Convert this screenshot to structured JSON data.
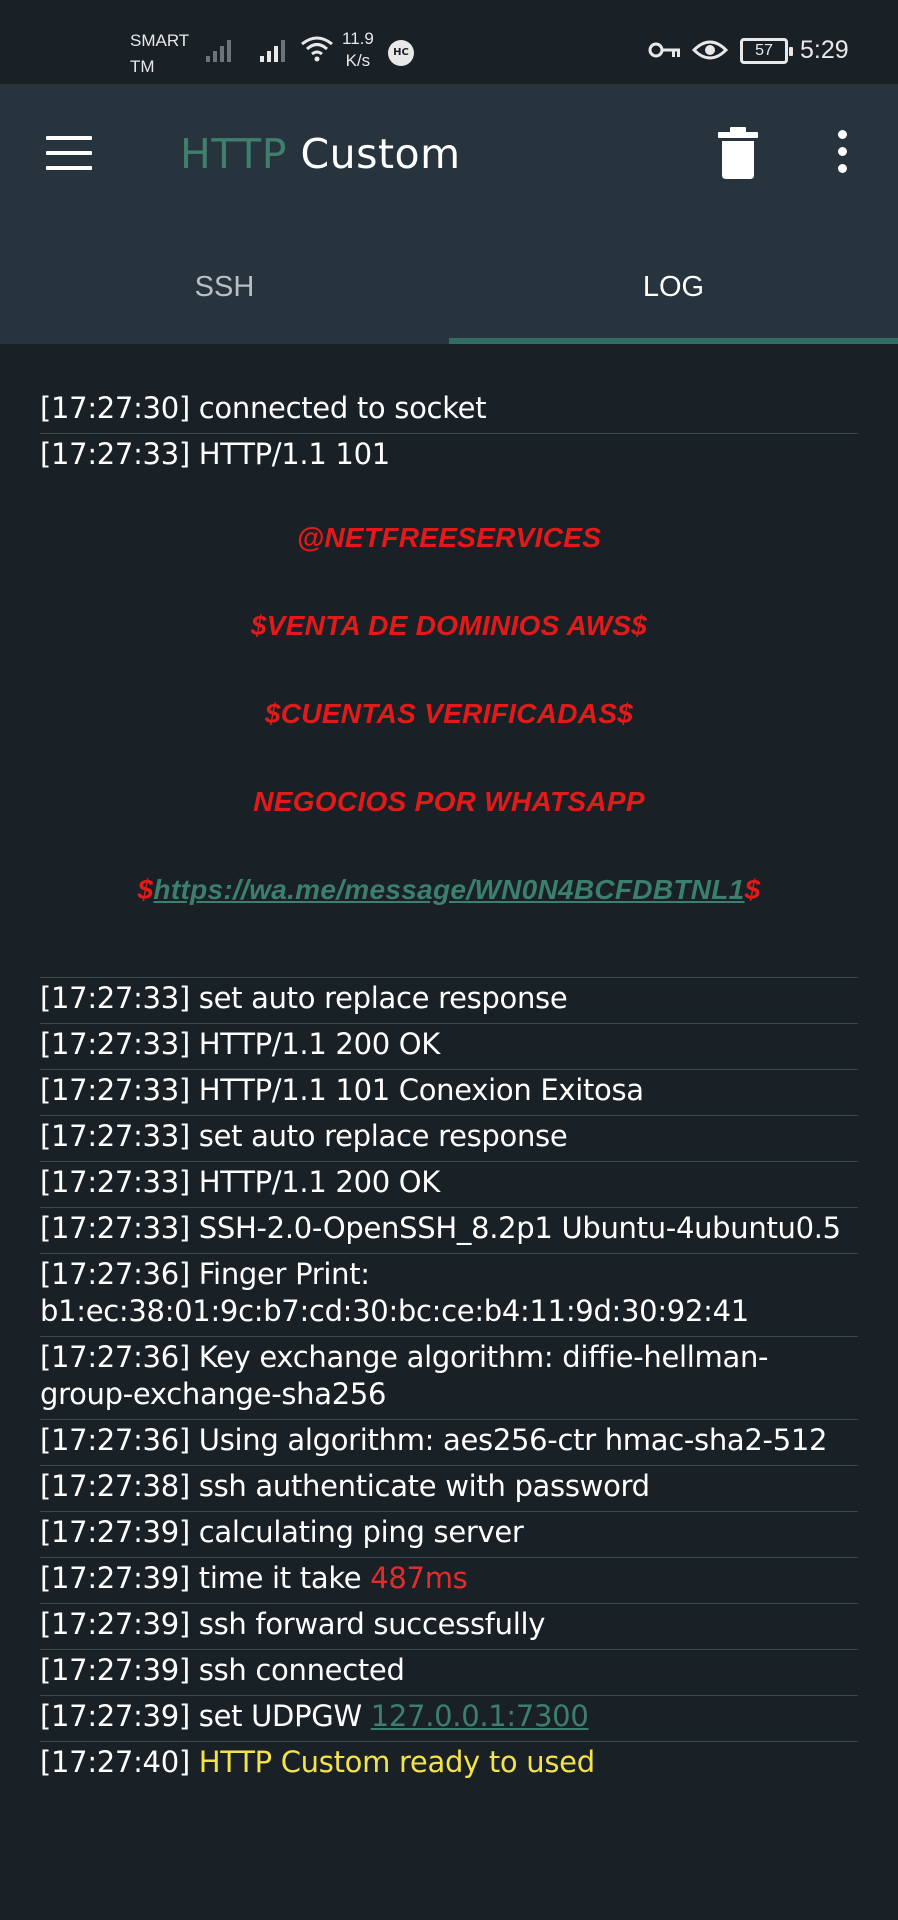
{
  "status_bar": {
    "carrier_line1": "SMART",
    "carrier_line2": "TM",
    "speed_value": "11.9",
    "speed_unit": "K/s",
    "hc_badge": "HC",
    "battery_level": "57",
    "time": "5:29"
  },
  "app_bar": {
    "title_part1": "HTTP",
    "title_part2": " Custom",
    "menu_icon": "hamburger-menu-icon",
    "delete_icon": "trash-icon",
    "more_icon": "more-vert-icon"
  },
  "tabs": [
    {
      "label": "SSH",
      "active": false
    },
    {
      "label": "LOG",
      "active": true
    }
  ],
  "colors": {
    "background": "#1a2126",
    "app_bar": "#28343d",
    "accent_green": "#3c7f6c",
    "banner_red": "#e41a1a",
    "ready_yellow": "#f3e24a"
  },
  "log": {
    "top": [
      "[17:27:30] connected to socket",
      "[17:27:33] HTTP/1.1 101"
    ],
    "banner": {
      "line1": "@NETFREESERVICES",
      "line2": "$VENTA DE DOMINIOS AWS$",
      "line3": "$CUENTAS VERIFICADAS$",
      "line4": "NEGOCIOS POR WHATSAPP",
      "link_prefix": "$",
      "link_text": "https://wa.me/message/WN0N4BCFDBTNL1",
      "link_suffix": "$"
    },
    "lines": [
      "[17:27:33] set auto replace response",
      "[17:27:33] HTTP/1.1 200 OK",
      "[17:27:33] HTTP/1.1 101 Conexion Exitosa",
      "[17:27:33] set auto replace response",
      "[17:27:33] HTTP/1.1 200 OK",
      "[17:27:33] SSH-2.0-OpenSSH_8.2p1 Ubuntu-4ubuntu0.5",
      "[17:27:36] Finger Print: b1:ec:38:01:9c:b7:cd:30:bc:ce:b4:11:9d:30:92:41",
      "[17:27:36] Key exchange algorithm: diffie-hellman-group-exchange-sha256",
      "[17:27:36] Using algorithm: aes256-ctr hmac-sha2-512",
      "[17:27:38] ssh authenticate with password",
      "[17:27:39] calculating ping server"
    ],
    "ping": {
      "prefix": "[17:27:39] time it take ",
      "value": "487ms"
    },
    "lines2": [
      "[17:27:39] ssh forward successfully",
      "[17:27:39] ssh connected"
    ],
    "udpgw": {
      "prefix": "[17:27:39] set UDPGW ",
      "value": "127.0.0.1:7300"
    },
    "ready": {
      "prefix": "[17:27:40] ",
      "value": "HTTP Custom ready to used"
    }
  }
}
